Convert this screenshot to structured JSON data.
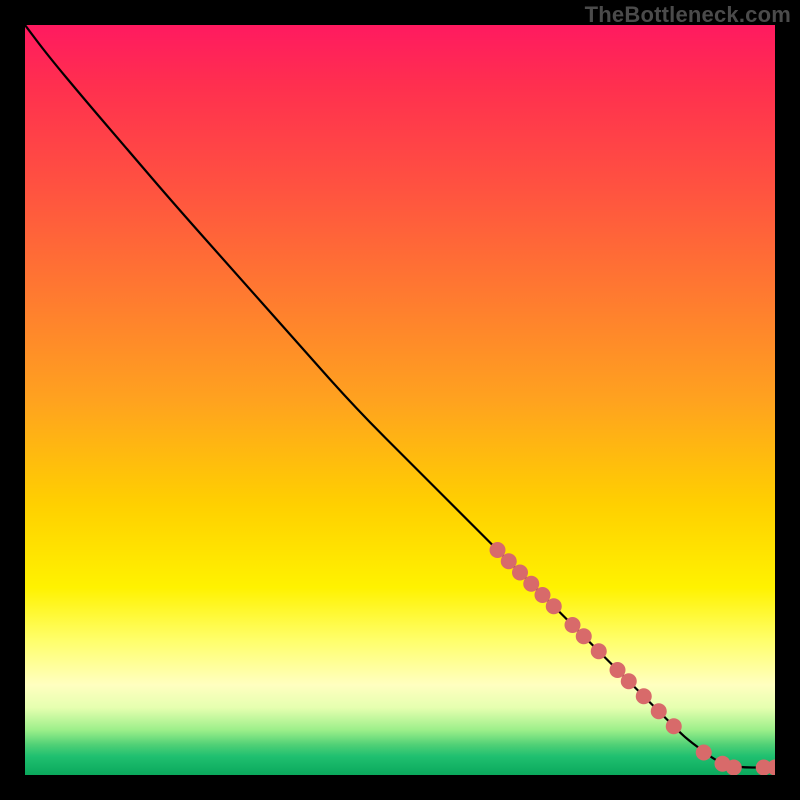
{
  "watermark": "TheBottleneck.com",
  "chart_data": {
    "type": "line",
    "title": "",
    "xlabel": "",
    "ylabel": "",
    "xlim": [
      0,
      100
    ],
    "ylim": [
      0,
      100
    ],
    "grid": false,
    "legend": false,
    "series": [
      {
        "name": "curve",
        "color": "#000000",
        "x": [
          0,
          3,
          8,
          14,
          20,
          28,
          36,
          44,
          52,
          60,
          66,
          70,
          74,
          78,
          82,
          86,
          88,
          90,
          92,
          94,
          96,
          98,
          100
        ],
        "y": [
          100,
          96,
          90,
          83,
          76,
          67,
          58,
          49,
          41,
          33,
          27,
          23,
          19,
          15,
          11,
          7,
          5,
          3.5,
          2,
          1.2,
          1,
          1,
          1
        ]
      }
    ],
    "markers": {
      "name": "highlight-points",
      "color": "#d86a6a",
      "radius_px": 8,
      "x": [
        63,
        64.5,
        66,
        67.5,
        69,
        70.5,
        73,
        74.5,
        76.5,
        79,
        80.5,
        82.5,
        84.5,
        86.5,
        90.5,
        93,
        94.5,
        98.5,
        100
      ],
      "y": [
        30,
        28.5,
        27,
        25.5,
        24,
        22.5,
        20,
        18.5,
        16.5,
        14,
        12.5,
        10.5,
        8.5,
        6.5,
        3,
        1.5,
        1,
        1,
        1
      ]
    }
  }
}
